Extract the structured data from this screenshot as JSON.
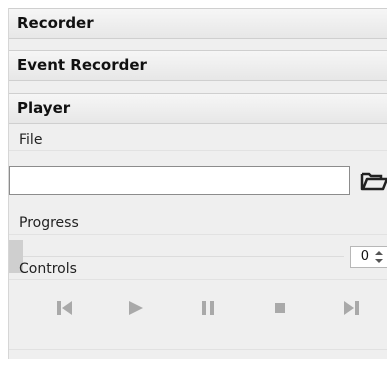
{
  "sections": {
    "recorder": "Recorder",
    "event_recorder": "Event Recorder",
    "player": "Player"
  },
  "player": {
    "file_label": "File",
    "file_value": "",
    "progress_label": "Progress",
    "progress_fraction": 0,
    "progress_value": "0",
    "controls_label": "Controls",
    "controls": [
      {
        "icon": "skip-to-start-icon"
      },
      {
        "icon": "play-icon"
      },
      {
        "icon": "pause-icon"
      },
      {
        "icon": "stop-icon"
      },
      {
        "icon": "skip-to-end-icon"
      }
    ]
  },
  "icons": {
    "folder": "folder-open-icon",
    "spinner": "spinner-arrows-icon"
  },
  "colors": {
    "panel_bg": "#efefef",
    "header_bg": "#e7e7e7",
    "disabled_icon": "#a9a9a9",
    "text": "#111111"
  }
}
